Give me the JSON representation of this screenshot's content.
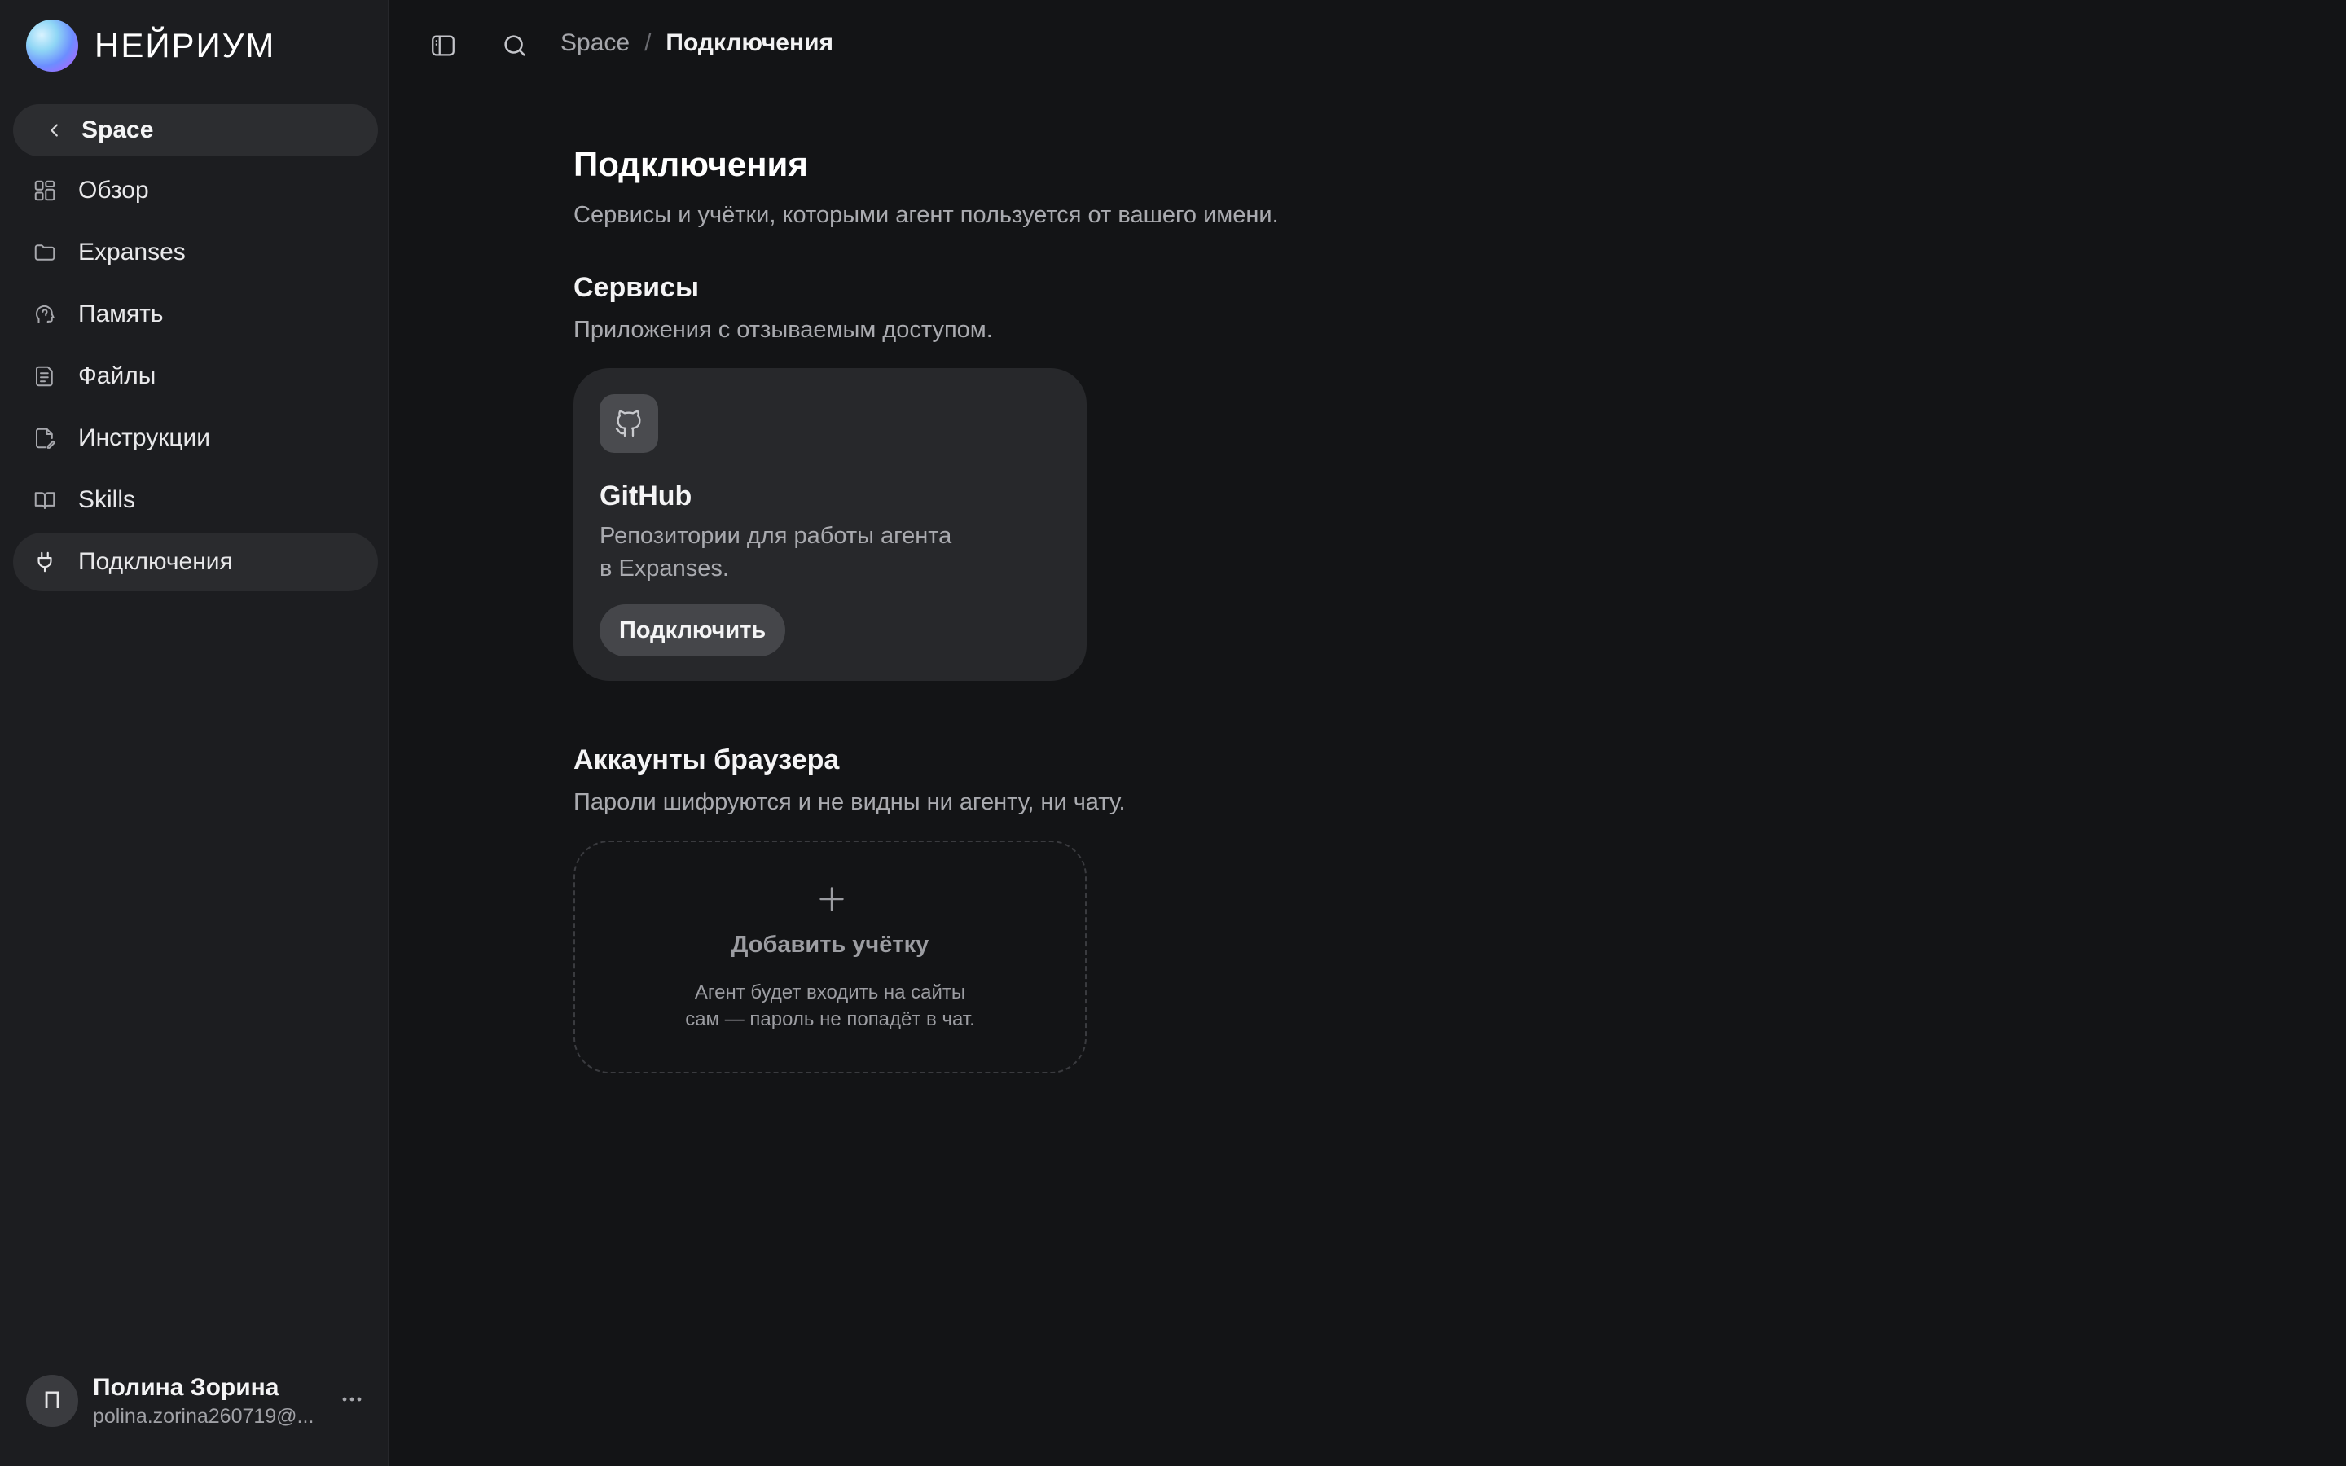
{
  "brand": {
    "name": "НЕЙРИУМ"
  },
  "sidebar": {
    "back_label": "Space",
    "items": [
      {
        "label": "Обзор",
        "icon": "grid-icon"
      },
      {
        "label": "Expanses",
        "icon": "folder-icon"
      },
      {
        "label": "Память",
        "icon": "brain-head-icon"
      },
      {
        "label": "Файлы",
        "icon": "document-icon"
      },
      {
        "label": "Инструкции",
        "icon": "edit-document-icon"
      },
      {
        "label": "Skills",
        "icon": "book-icon"
      },
      {
        "label": "Подключения",
        "icon": "plug-icon",
        "active": true
      }
    ]
  },
  "user": {
    "initial": "П",
    "name": "Полина Зорина",
    "email": "polina.zorina260719@..."
  },
  "breadcrumb": {
    "root": "Space",
    "separator": "/",
    "current": "Подключения"
  },
  "page": {
    "title": "Подключения",
    "subtitle": "Сервисы и учётки, которыми агент пользуется от вашего имени."
  },
  "services": {
    "title": "Сервисы",
    "subtitle": "Приложения с отзываемым доступом.",
    "cards": [
      {
        "icon": "github-icon",
        "title": "GitHub",
        "desc_line1": "Репозитории для работы агента",
        "desc_line2": "в Expanses.",
        "button": "Подключить"
      }
    ]
  },
  "browser_accounts": {
    "title": "Аккаунты браузера",
    "subtitle": "Пароли шифруются и не видны ни агенту, ни чату.",
    "add": {
      "title": "Добавить учётку",
      "desc_line1": "Агент будет входить на сайты",
      "desc_line2": "сам — пароль не попадёт в чат."
    }
  },
  "colors": {
    "background": "#131416",
    "sidebar": "#1c1d20",
    "card": "#27282b",
    "active_item": "#2a2b2e"
  }
}
